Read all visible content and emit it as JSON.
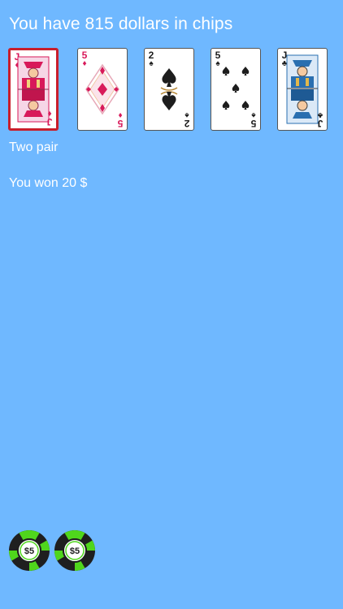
{
  "status": {
    "balance_text": "You have 815 dollars in chips",
    "hand_rank": "Two pair",
    "result_text": "You won 20 $"
  },
  "cards": [
    {
      "rank": "J",
      "suit": "diamonds",
      "suit_symbol": "♦",
      "held": true
    },
    {
      "rank": "5",
      "suit": "diamonds",
      "suit_symbol": "♦",
      "held": false
    },
    {
      "rank": "2",
      "suit": "spades",
      "suit_symbol": "♠",
      "held": false
    },
    {
      "rank": "5",
      "suit": "spades",
      "suit_symbol": "♠",
      "held": false
    },
    {
      "rank": "J",
      "suit": "clubs",
      "suit_symbol": "♣",
      "held": false
    }
  ],
  "chips": [
    {
      "label": "$5"
    },
    {
      "label": "$5"
    }
  ],
  "colors": {
    "background": "#6fb8ff",
    "held_border": "#c91e2b",
    "chip_green": "#4fd61c",
    "red_suit": "#d8195a"
  }
}
